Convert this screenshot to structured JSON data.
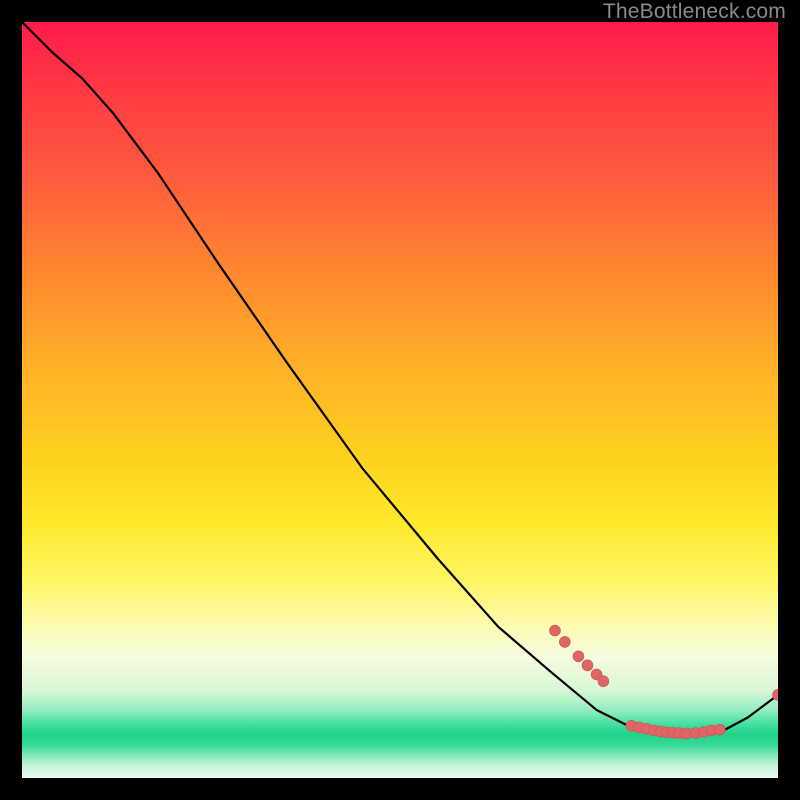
{
  "watermark": "TheBottleneck.com",
  "colors": {
    "curve": "#000000",
    "points_fill": "#e06666",
    "points_stroke": "#ce5a5a"
  },
  "chart_data": {
    "type": "line",
    "title": "",
    "xlabel": "",
    "ylabel": "",
    "x_range": [
      0,
      100
    ],
    "y_range": [
      0,
      100
    ],
    "curve": [
      {
        "x": 0,
        "y": 100
      },
      {
        "x": 4,
        "y": 96
      },
      {
        "x": 8,
        "y": 92.5
      },
      {
        "x": 12,
        "y": 88
      },
      {
        "x": 18,
        "y": 80
      },
      {
        "x": 26,
        "y": 68
      },
      {
        "x": 35,
        "y": 55
      },
      {
        "x": 45,
        "y": 41
      },
      {
        "x": 55,
        "y": 29
      },
      {
        "x": 63,
        "y": 20
      },
      {
        "x": 70,
        "y": 14
      },
      {
        "x": 76,
        "y": 9
      },
      {
        "x": 81,
        "y": 6.5
      },
      {
        "x": 85,
        "y": 5.7
      },
      {
        "x": 89,
        "y": 5.6
      },
      {
        "x": 93,
        "y": 6.4
      },
      {
        "x": 96,
        "y": 8.0
      },
      {
        "x": 100,
        "y": 11.0
      }
    ],
    "points": [
      {
        "x": 70.5,
        "y": 19.5
      },
      {
        "x": 71.8,
        "y": 18.0
      },
      {
        "x": 73.6,
        "y": 16.1
      },
      {
        "x": 74.8,
        "y": 14.9
      },
      {
        "x": 76.0,
        "y": 13.7
      },
      {
        "x": 76.9,
        "y": 12.8
      },
      {
        "x": 80.6,
        "y": 6.9
      },
      {
        "x": 81.6,
        "y": 6.7
      },
      {
        "x": 82.6,
        "y": 6.5
      },
      {
        "x": 83.6,
        "y": 6.3
      },
      {
        "x": 84.5,
        "y": 6.15
      },
      {
        "x": 85.3,
        "y": 6.05
      },
      {
        "x": 86.1,
        "y": 6.0
      },
      {
        "x": 86.9,
        "y": 5.95
      },
      {
        "x": 87.9,
        "y": 5.9
      },
      {
        "x": 89.1,
        "y": 5.95
      },
      {
        "x": 90.2,
        "y": 6.1
      },
      {
        "x": 91.2,
        "y": 6.3
      },
      {
        "x": 92.3,
        "y": 6.4
      },
      {
        "x": 100.0,
        "y": 11.0
      }
    ],
    "point_radius": 5.4
  }
}
